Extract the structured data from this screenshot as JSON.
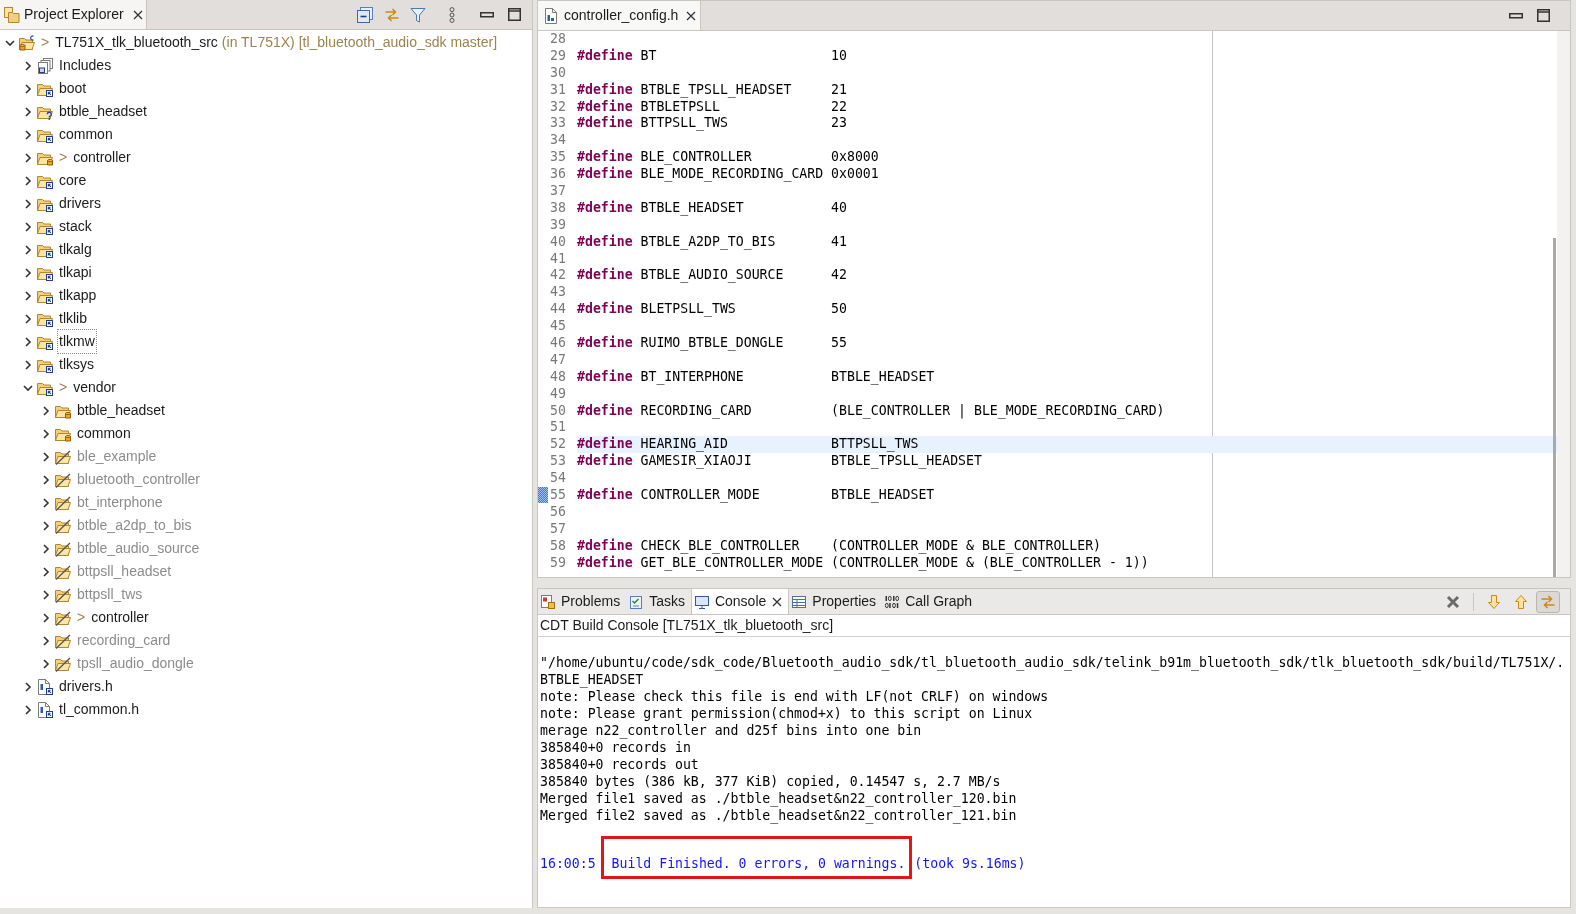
{
  "project_explorer": {
    "tab": {
      "label": "Project Explorer",
      "selected": true
    },
    "tree": [
      {
        "label": "TL751X_tlk_bluetooth_src",
        "prefix": ">",
        "decoration": "(in TL751X) [tl_bluetooth_audio_sdk master]",
        "kind": "project",
        "expanded": true,
        "dimmed": false,
        "focused": false,
        "children": [
          {
            "label": "Includes",
            "kind": "includes",
            "expanded": false,
            "dimmed": false,
            "focused": false
          },
          {
            "label": "boot",
            "kind": "source_folder",
            "expanded": false,
            "dimmed": false,
            "focused": false
          },
          {
            "label": "btble_headset",
            "kind": "unknown_folder",
            "expanded": false,
            "dimmed": false,
            "focused": false
          },
          {
            "label": "common",
            "kind": "source_folder",
            "expanded": false,
            "dimmed": false,
            "focused": false
          },
          {
            "label": "controller",
            "prefix": ">",
            "kind": "git_folder",
            "expanded": false,
            "dimmed": false,
            "focused": false
          },
          {
            "label": "core",
            "kind": "source_folder",
            "expanded": false,
            "dimmed": false,
            "focused": false
          },
          {
            "label": "drivers",
            "kind": "source_folder",
            "expanded": false,
            "dimmed": false,
            "focused": false
          },
          {
            "label": "stack",
            "kind": "source_folder",
            "expanded": false,
            "dimmed": false,
            "focused": false
          },
          {
            "label": "tlkalg",
            "kind": "source_folder",
            "expanded": false,
            "dimmed": false,
            "focused": false
          },
          {
            "label": "tlkapi",
            "kind": "source_folder",
            "expanded": false,
            "dimmed": false,
            "focused": false
          },
          {
            "label": "tlkapp",
            "kind": "source_folder",
            "expanded": false,
            "dimmed": false,
            "focused": false
          },
          {
            "label": "tlklib",
            "kind": "source_folder",
            "expanded": false,
            "dimmed": false,
            "focused": false
          },
          {
            "label": "tlkmw",
            "kind": "source_folder",
            "expanded": false,
            "dimmed": false,
            "focused": true
          },
          {
            "label": "tlksys",
            "kind": "source_folder",
            "expanded": false,
            "dimmed": false,
            "focused": false
          },
          {
            "label": "vendor",
            "prefix": ">",
            "kind": "source_folder",
            "expanded": true,
            "dimmed": false,
            "focused": false,
            "children": [
              {
                "label": "btble_headset",
                "kind": "git_folder",
                "expanded": false,
                "dimmed": false,
                "focused": false
              },
              {
                "label": "common",
                "kind": "git_folder",
                "expanded": false,
                "dimmed": false,
                "focused": false
              },
              {
                "label": "ble_example",
                "kind": "excluded_folder",
                "expanded": false,
                "dimmed": true,
                "focused": false
              },
              {
                "label": "bluetooth_controller",
                "kind": "excluded_folder",
                "expanded": false,
                "dimmed": true,
                "focused": false
              },
              {
                "label": "bt_interphone",
                "kind": "excluded_folder",
                "expanded": false,
                "dimmed": true,
                "focused": false
              },
              {
                "label": "btble_a2dp_to_bis",
                "kind": "excluded_folder",
                "expanded": false,
                "dimmed": true,
                "focused": false
              },
              {
                "label": "btble_audio_source",
                "kind": "excluded_folder",
                "expanded": false,
                "dimmed": true,
                "focused": false
              },
              {
                "label": "bttpsll_headset",
                "kind": "excluded_folder",
                "expanded": false,
                "dimmed": true,
                "focused": false
              },
              {
                "label": "bttpsll_tws",
                "kind": "excluded_folder",
                "expanded": false,
                "dimmed": true,
                "focused": false
              },
              {
                "label": "controller",
                "prefix": ">",
                "kind": "excluded_folder",
                "expanded": false,
                "dimmed": false,
                "focused": false
              },
              {
                "label": "recording_card",
                "kind": "excluded_folder",
                "expanded": false,
                "dimmed": true,
                "focused": false
              },
              {
                "label": "tpsll_audio_dongle",
                "kind": "excluded_folder",
                "expanded": false,
                "dimmed": true,
                "focused": false
              }
            ]
          },
          {
            "label": "drivers.h",
            "kind": "header",
            "expanded": false,
            "dimmed": false,
            "focused": false
          },
          {
            "label": "tl_common.h",
            "kind": "header",
            "expanded": false,
            "dimmed": false,
            "focused": false
          }
        ]
      }
    ]
  },
  "editor": {
    "tabs": [
      {
        "label": "controller_config.h",
        "selected": true
      }
    ],
    "lines": [
      {
        "number": "28",
        "current": false,
        "marker": false
      },
      {
        "number": "29",
        "keyword": "#define",
        "name": "BT",
        "value": "10",
        "current": false,
        "marker": false
      },
      {
        "number": "30",
        "current": false,
        "marker": false
      },
      {
        "number": "31",
        "keyword": "#define",
        "name": "BTBLE_TPSLL_HEADSET",
        "value": "21",
        "current": false,
        "marker": false
      },
      {
        "number": "32",
        "keyword": "#define",
        "name": "BTBLETPSLL",
        "value": "22",
        "current": false,
        "marker": false
      },
      {
        "number": "33",
        "keyword": "#define",
        "name": "BTTPSLL_TWS",
        "value": "23",
        "current": false,
        "marker": false
      },
      {
        "number": "34",
        "current": false,
        "marker": false
      },
      {
        "number": "35",
        "keyword": "#define",
        "name": "BLE_CONTROLLER",
        "value": "0x8000",
        "current": false,
        "marker": false
      },
      {
        "number": "36",
        "keyword": "#define",
        "name": "BLE_MODE_RECORDING_CARD",
        "value": "0x0001",
        "current": false,
        "marker": false
      },
      {
        "number": "37",
        "current": false,
        "marker": false
      },
      {
        "number": "38",
        "keyword": "#define",
        "name": "BTBLE_HEADSET",
        "value": "40",
        "current": false,
        "marker": false
      },
      {
        "number": "39",
        "current": false,
        "marker": false
      },
      {
        "number": "40",
        "keyword": "#define",
        "name": "BTBLE_A2DP_TO_BIS",
        "value": "41",
        "current": false,
        "marker": false
      },
      {
        "number": "41",
        "current": false,
        "marker": false
      },
      {
        "number": "42",
        "keyword": "#define",
        "name": "BTBLE_AUDIO_SOURCE",
        "value": "42",
        "current": false,
        "marker": false
      },
      {
        "number": "43",
        "current": false,
        "marker": false
      },
      {
        "number": "44",
        "keyword": "#define",
        "name": "BLETPSLL_TWS",
        "value": "50",
        "current": false,
        "marker": false
      },
      {
        "number": "45",
        "current": false,
        "marker": false
      },
      {
        "number": "46",
        "keyword": "#define",
        "name": "RUIMO_BTBLE_DONGLE",
        "value": "55",
        "current": false,
        "marker": false
      },
      {
        "number": "47",
        "current": false,
        "marker": false
      },
      {
        "number": "48",
        "keyword": "#define",
        "name": "BT_INTERPHONE",
        "value": "BTBLE_HEADSET",
        "current": false,
        "marker": false
      },
      {
        "number": "49",
        "current": false,
        "marker": false
      },
      {
        "number": "50",
        "keyword": "#define",
        "name": "RECORDING_CARD",
        "value": "(BLE_CONTROLLER | BLE_MODE_RECORDING_CARD)",
        "current": false,
        "marker": false
      },
      {
        "number": "51",
        "current": false,
        "marker": false
      },
      {
        "number": "52",
        "keyword": "#define",
        "name": "HEARING_AID",
        "value": "BTTPSLL_TWS",
        "current": true,
        "marker": false
      },
      {
        "number": "53",
        "keyword": "#define",
        "name": "GAMESIR_XIAOJI",
        "value": "BTBLE_TPSLL_HEADSET",
        "current": false,
        "marker": false
      },
      {
        "number": "54",
        "current": false,
        "marker": false
      },
      {
        "number": "55",
        "keyword": "#define",
        "name": "CONTROLLER_MODE",
        "value": "BTBLE_HEADSET",
        "current": false,
        "marker": true
      },
      {
        "number": "56",
        "current": false,
        "marker": false
      },
      {
        "number": "57",
        "current": false,
        "marker": false
      },
      {
        "number": "58",
        "keyword": "#define",
        "name": "CHECK_BLE_CONTROLLER",
        "value": "(CONTROLLER_MODE & BLE_CONTROLLER)",
        "current": false,
        "marker": false
      },
      {
        "number": "59",
        "keyword": "#define",
        "name": "GET_BLE_CONTROLLER_MODE",
        "value": "(CONTROLLER_MODE & (BLE_CONTROLLER - 1))",
        "current": false,
        "marker": false
      }
    ]
  },
  "bottom_panel": {
    "tabs": [
      {
        "label": "Problems",
        "kind": "problems",
        "selected": false
      },
      {
        "label": "Tasks",
        "kind": "tasks",
        "selected": false
      },
      {
        "label": "Console",
        "kind": "console",
        "selected": true
      },
      {
        "label": "Properties",
        "kind": "properties",
        "selected": false
      },
      {
        "label": "Call Graph",
        "kind": "call_graph",
        "selected": false
      }
    ],
    "toolbar": [
      {
        "pressed": false
      },
      {
        "pressed": false
      },
      {
        "pressed": false
      },
      {
        "pressed": true
      }
    ],
    "console": {
      "title": "CDT Build Console [TL751X_tlk_bluetooth_src]",
      "lines": [
        "\"/home/ubuntu/code/sdk_code/Bluetooth_audio_sdk/tl_bluetooth_audio_sdk/telink_b91m_bluetooth_sdk/tlk_bluetooth_sdk/build/TL751X/.",
        "BTBLE_HEADSET",
        "note: Please check this file is end with LF(not CRLF) on windows",
        "note: Please grant permission(chmod+x) to this script on Linux",
        "merage n22_controller and d25f bins into one bin",
        "385840+0 records in",
        "385840+0 records out",
        "385840 bytes (386 kB, 377 KiB) copied, 0.14547 s, 2.7 MB/s",
        "Merged file1 saved as ./btble_headset&n22_controller_120.bin",
        "Merged file2 saved as ./btble_headset&n22_controller_121.bin"
      ],
      "status_line": [
        {
          "text": "16:00:5",
          "highlighted": false
        },
        {
          "text": "Build Finished. 0 errors, 0 warnings.",
          "highlighted": true
        },
        {
          "text": "(took 9s.16ms)",
          "highlighted": false
        }
      ]
    }
  }
}
